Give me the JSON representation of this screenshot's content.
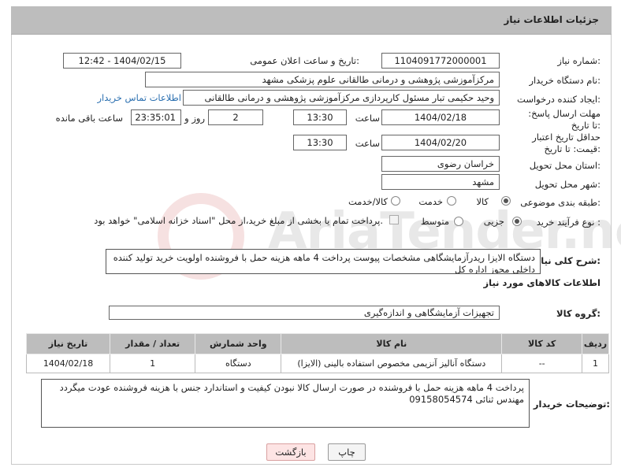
{
  "header": {
    "title": "جزئیات اطلاعات نیاز"
  },
  "form": {
    "need_number_label": "شماره نیاز:",
    "need_number": "1104091772000001",
    "announce_label": "تاریخ و ساعت اعلان عمومی:",
    "announce_value": "1404/02/15 - 12:42",
    "buyer_org_label": "نام دستگاه خریدار:",
    "buyer_org": "مرکزآموزشی  پژوهشی و درمانی طالقانی   علوم پزشکی مشهد",
    "creator_label": "ایجاد کننده درخواست:",
    "creator": "وحید حکیمی تبار مسئول کارپردازی مرکزآموزشی  پژوهشی و درمانی طالقانی",
    "contact_link": "اطلاعات تماس خریدار",
    "reply_deadline_label": "مهلت ارسال پاسخ: تا تاریخ:",
    "reply_date": "1404/02/18",
    "time_label": "ساعت",
    "reply_time": "13:30",
    "days_value": "2",
    "days_label": "روز و",
    "remaining_time": "23:35:01",
    "remaining_label": "ساعت باقی مانده",
    "price_validity_label": "حداقل تاریخ اعتبار قیمت: تا تاریخ:",
    "price_date": "1404/02/20",
    "price_time": "13:30",
    "province_label": "استان محل تحویل:",
    "province": "خراسان رضوی",
    "city_label": "شهر محل تحویل:",
    "city": "مشهد",
    "category_label": "طبقه بندی موضوعی:",
    "category_options": [
      "کالا",
      "خدمت",
      "کالا/خدمت"
    ],
    "process_label": "نوع فرآیند خرید :",
    "process_options": [
      "جزیی",
      "متوسط"
    ],
    "payment_note": "پرداخت تمام یا بخشی از مبلغ خرید،از محل \"اسناد خزانه اسلامی\" خواهد بود.",
    "description_label": "شرح کلی نیاز:",
    "description": "دستگاه الایزا ریدرآزمایشگاهی مشخصات پیوست  پرداخت 4 ماهه هزینه حمل با فروشنده اولویت خرید تولید کننده داخلی مجوز اداره کل",
    "goods_info_title": "اطلاعات کالاهای مورد نیاز",
    "goods_group_label": "گروه کالا:",
    "goods_group": "تجهیزات آزمایشگاهی و اندازه‌گیری"
  },
  "table": {
    "headers": [
      "ردیف",
      "کد کالا",
      "نام کالا",
      "واحد شمارش",
      "تعداد / مقدار",
      "تاریخ نیاز"
    ],
    "rows": [
      [
        "1",
        "--",
        "دستگاه آنالیز آنزیمی مخصوص استفاده بالینی (الایزا)",
        "دستگاه",
        "1",
        "1404/02/18"
      ]
    ]
  },
  "buyer_notes_label": "توضیحات خریدار:",
  "buyer_notes": "پرداخت 4 ماهه هزینه حمل با فروشنده در صورت ارسال کالا نبودن کیفیت و استاندارد جنس با هزینه فروشنده عودت میگردد مهندس ثنائی 09158054574",
  "buttons": {
    "print": "چاپ",
    "back": "بازگشت"
  },
  "watermark": {
    "text": "AriaTender.neT"
  }
}
